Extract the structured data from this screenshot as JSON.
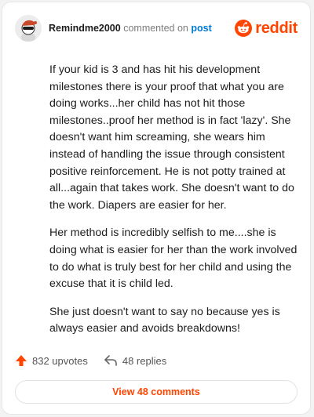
{
  "comment": {
    "username": "Remindme2000",
    "action_text": "commented on",
    "target_link": "post",
    "paragraphs": [
      "If your kid is 3 and has hit his development milestones there is your proof that what you are doing works...her child has not hit those milestones..proof her method is in fact 'lazy'. She doesn't want him screaming, she wears him instead of handling the issue through consistent positive reinforcement. He is not potty trained at all...again that takes work. She doesn't want to do the work. Diapers are easier for her.",
      "Her method is incredibly selfish to me....she is doing what is easier for her than the work involved to do what is truly best for her child and using the excuse that it is child led.",
      "She just doesn't want to say no because yes is always easier and avoids breakdowns!"
    ]
  },
  "brand": {
    "wordmark": "reddit",
    "color": "#ff4500"
  },
  "stats": {
    "upvotes": "832 upvotes",
    "replies": "48 replies"
  },
  "view_button": {
    "label": "View 48 comments"
  },
  "icons": [
    "avatar",
    "reddit-logo-icon",
    "upvote-arrow-icon",
    "reply-arrow-icon"
  ]
}
